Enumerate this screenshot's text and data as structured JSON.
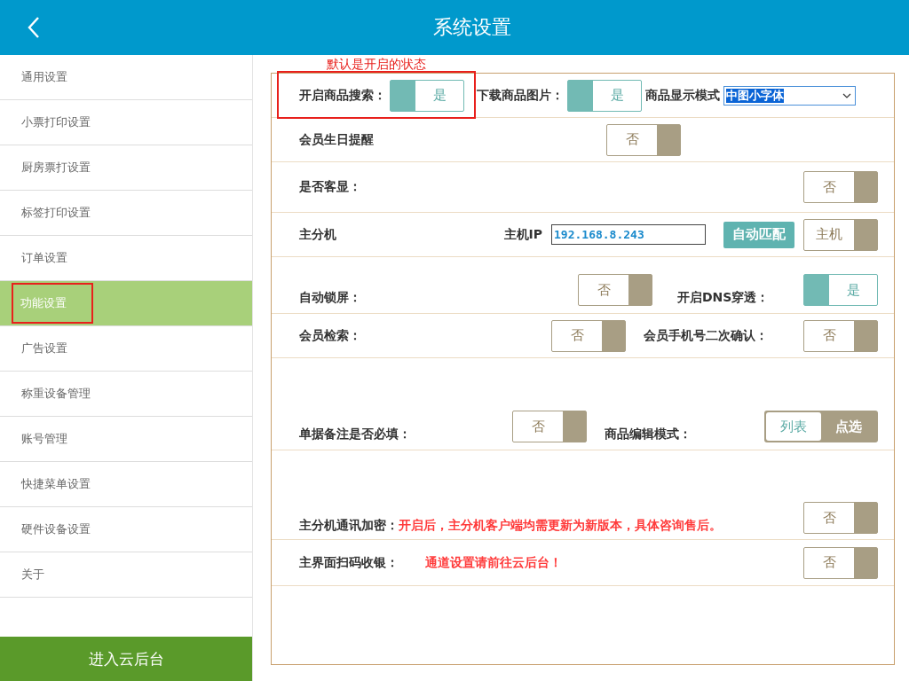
{
  "header": {
    "title": "系统设置"
  },
  "sidebar": {
    "items": [
      {
        "label": "通用设置",
        "selected": false,
        "highlighted": false
      },
      {
        "label": "小票打印设置",
        "selected": false,
        "highlighted": false
      },
      {
        "label": "厨房票打设置",
        "selected": false,
        "highlighted": false
      },
      {
        "label": "标签打印设置",
        "selected": false,
        "highlighted": false
      },
      {
        "label": "订单设置",
        "selected": false,
        "highlighted": false
      },
      {
        "label": "功能设置",
        "selected": true,
        "highlighted": true
      },
      {
        "label": "广告设置",
        "selected": false,
        "highlighted": false
      },
      {
        "label": "称重设备管理",
        "selected": false,
        "highlighted": false
      },
      {
        "label": "账号管理",
        "selected": false,
        "highlighted": false
      },
      {
        "label": "快捷菜单设置",
        "selected": false,
        "highlighted": false
      },
      {
        "label": "硬件设备设置",
        "selected": false,
        "highlighted": false
      },
      {
        "label": "关于",
        "selected": false,
        "highlighted": false
      }
    ],
    "footer_button": "进入云后台"
  },
  "annotation": {
    "text": "默认是开启的状态"
  },
  "settings": [
    {
      "label": "开启商品搜索：",
      "highlighted": true,
      "items": [
        {
          "kind": "toggle",
          "text": "是",
          "on": true
        },
        {
          "kind": "label",
          "text": "下载商品图片："
        },
        {
          "kind": "toggle",
          "text": "是",
          "on": true
        },
        {
          "kind": "label",
          "text": "商品显示模式"
        },
        {
          "kind": "select",
          "value": "中图小字体"
        }
      ]
    },
    {
      "label": "会员生日提醒",
      "highlighted": false,
      "items": [
        {
          "kind": "toggle",
          "text": "否",
          "on": false
        }
      ]
    },
    {
      "label": "是否客显：",
      "highlighted": false,
      "items": [
        {
          "kind": "toggle",
          "text": "否",
          "on": false
        }
      ]
    },
    {
      "label": "主分机",
      "highlighted": false,
      "items": [
        {
          "kind": "label",
          "text": "主机IP"
        },
        {
          "kind": "ip",
          "value": "192.168.8.243"
        },
        {
          "kind": "button",
          "text": "自动匹配"
        },
        {
          "kind": "toggle",
          "text": "主机",
          "on": false
        }
      ]
    },
    {
      "label": "自动锁屏：",
      "highlighted": false,
      "items": [
        {
          "kind": "toggle",
          "text": "否",
          "on": false
        },
        {
          "kind": "label",
          "text": "开启DNS穿透："
        },
        {
          "kind": "toggle",
          "text": "是",
          "on": true
        }
      ]
    },
    {
      "label": "会员检索：",
      "highlighted": false,
      "items": [
        {
          "kind": "toggle",
          "text": "否",
          "on": false
        },
        {
          "kind": "label",
          "text": "会员手机号二次确认："
        },
        {
          "kind": "toggle",
          "text": "否",
          "on": false
        }
      ]
    },
    {
      "label": "单据备注是否必填：",
      "highlighted": false,
      "items": [
        {
          "kind": "toggle",
          "text": "否",
          "on": false
        },
        {
          "kind": "label",
          "text": "商品编辑模式："
        },
        {
          "kind": "segmented",
          "options": [
            {
              "text": "列表",
              "selected": true
            },
            {
              "text": "点选",
              "selected": false
            }
          ]
        }
      ]
    },
    {
      "label": "主分机通讯加密：",
      "highlighted": false,
      "items": [
        {
          "kind": "note",
          "text": "开启后，主分机客户端均需更新为新版本，具体咨询售后。"
        },
        {
          "kind": "toggle",
          "text": "否",
          "on": false
        }
      ]
    },
    {
      "label": "主界面扫码收银：",
      "highlighted": false,
      "items": [
        {
          "kind": "note",
          "text": "通道设置请前往云后台！"
        },
        {
          "kind": "toggle",
          "text": "否",
          "on": false
        }
      ]
    }
  ]
}
